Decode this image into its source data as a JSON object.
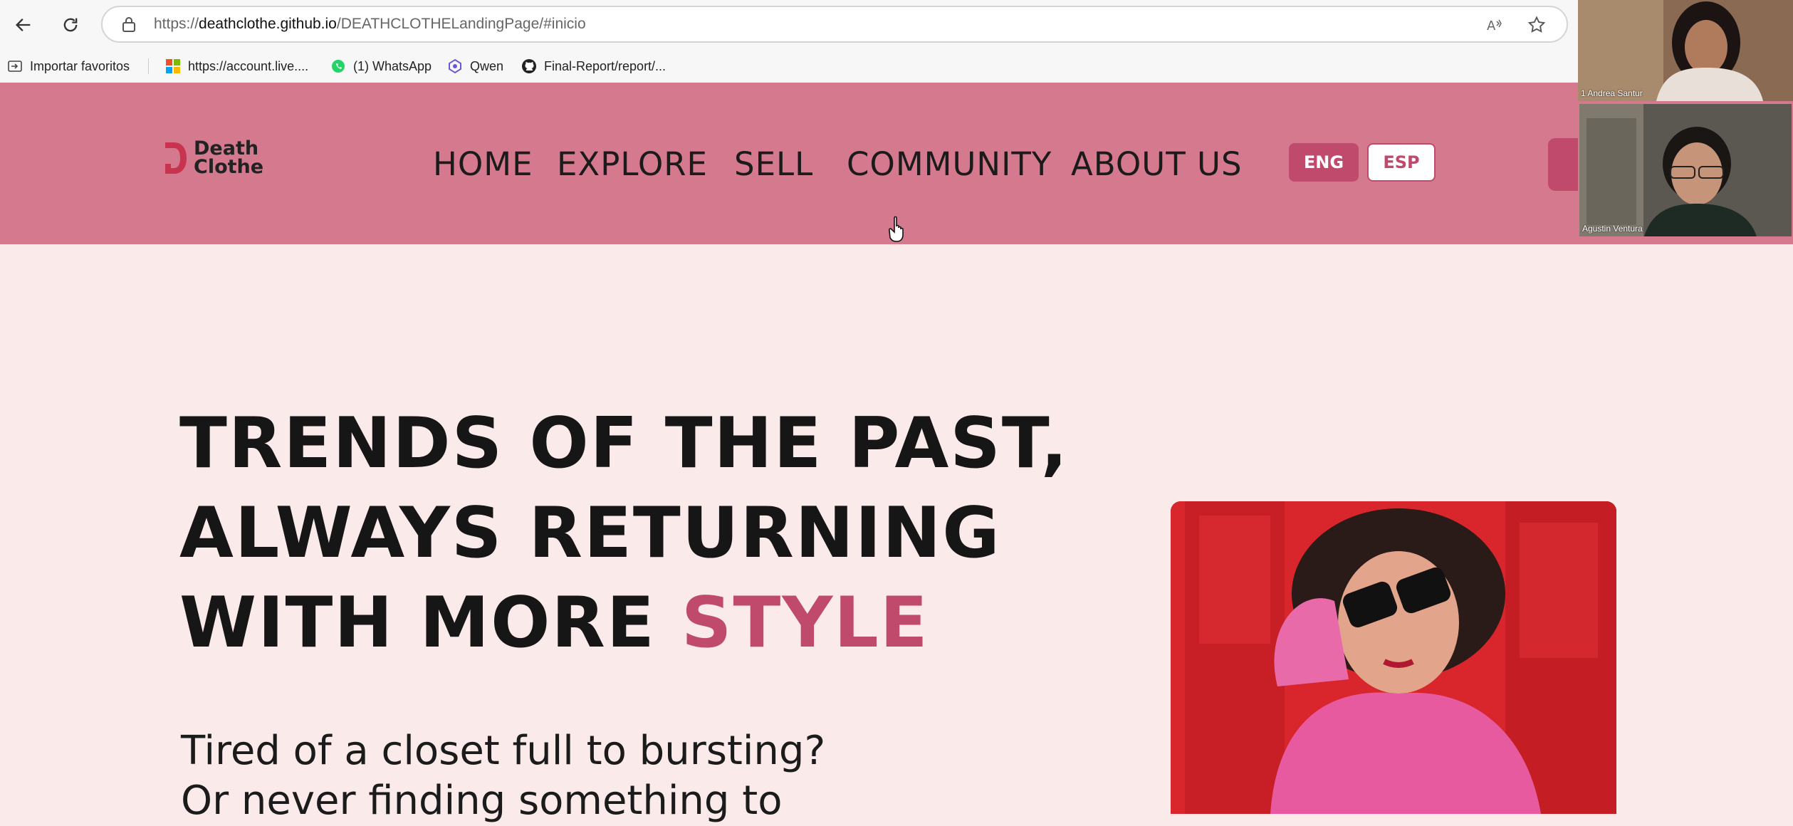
{
  "browser": {
    "url_prefix": "https://",
    "url_host": "deathclothe.github.io",
    "url_path": "/DEATHCLOTHELandingPage/#inicio",
    "bookmarks": [
      {
        "label": "Importar favoritos",
        "icon": "import-favorites-icon"
      },
      {
        "label": "https://account.live....",
        "icon": "microsoft-logo-icon"
      },
      {
        "label": "(1) WhatsApp",
        "icon": "whatsapp-icon"
      },
      {
        "label": "Qwen",
        "icon": "qwen-icon"
      },
      {
        "label": "Final-Report/report/...",
        "icon": "github-icon"
      }
    ]
  },
  "site": {
    "logo_line1": "Death",
    "logo_line2": "Clothe",
    "nav": [
      "HOME",
      "EXPLORE",
      "SELL",
      "COMMUNITY",
      "ABOUT US"
    ],
    "lang_eng": "ENG",
    "lang_esp": "ESP",
    "accent_color": "#c04a6c",
    "header_color": "#d4798e"
  },
  "hero": {
    "title_line1": "TRENDS OF THE PAST,",
    "title_line2": "ALWAYS RETURNING",
    "title_line3_plain": "WITH MORE ",
    "title_line3_accent": "STYLE",
    "subtitle_line1": "Tired of a closet full to bursting?",
    "subtitle_line2": "Or never finding something to"
  },
  "call": {
    "participant1": "1 Andrea Santur",
    "participant2": "Agustin Ventura"
  }
}
